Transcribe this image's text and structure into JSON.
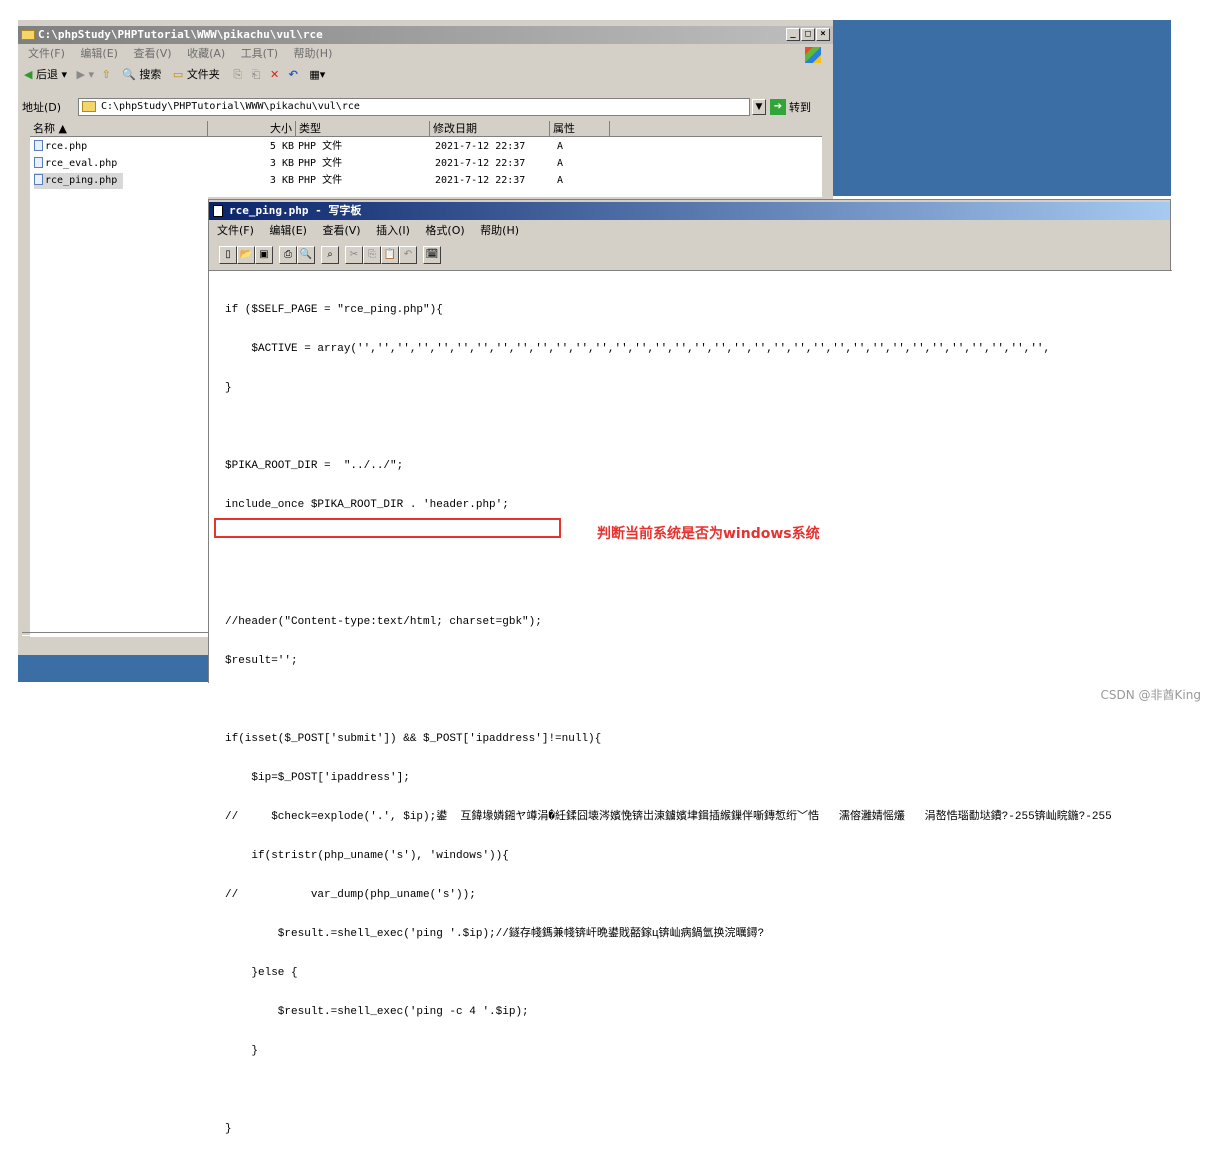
{
  "explorer": {
    "title": "C:\\phpStudy\\PHPTutorial\\WWW\\pikachu\\vul\\rce",
    "menu": [
      "文件(F)",
      "编辑(E)",
      "查看(V)",
      "收藏(A)",
      "工具(T)",
      "帮助(H)"
    ],
    "toolbar": {
      "back": "后退",
      "search": "搜索",
      "folders": "文件夹"
    },
    "address_label": "地址(D)",
    "address_value": "C:\\phpStudy\\PHPTutorial\\WWW\\pikachu\\vul\\rce",
    "go_label": "转到",
    "columns": {
      "name": "名称 ▲",
      "size": "大小",
      "type": "类型",
      "modified": "修改日期",
      "attr": "属性"
    },
    "files": [
      {
        "name": "rce.php",
        "size": "5 KB",
        "type": "PHP 文件",
        "modified": "2021-7-12 22:37",
        "attr": "A"
      },
      {
        "name": "rce_eval.php",
        "size": "3 KB",
        "type": "PHP 文件",
        "modified": "2021-7-12 22:37",
        "attr": "A"
      },
      {
        "name": "rce_ping.php",
        "size": "3 KB",
        "type": "PHP 文件",
        "modified": "2021-7-12 22:37",
        "attr": "A"
      }
    ]
  },
  "wordpad": {
    "title": "rce_ping.php - 写字板",
    "menu": [
      "文件(F)",
      "编辑(E)",
      "查看(V)",
      "插入(I)",
      "格式(O)",
      "帮助(H)"
    ],
    "code_lines": [
      "if ($SELF_PAGE = \"rce_ping.php\"){",
      "    $ACTIVE = array('','','','','','','','','','','','','','','','','','','','','','','','','','','','','','','','','','','',",
      "}",
      "",
      "$PIKA_ROOT_DIR =  \"../../\";",
      "include_once $PIKA_ROOT_DIR . 'header.php';",
      "",
      "",
      "//header(\"Content-type:text/html; charset=gbk\");",
      "$result='';",
      "",
      "if(isset($_POST['submit']) && $_POST['ipaddress']!=null){",
      "    $ip=$_POST['ipaddress'];",
      "//     $check=explode('.', $ip);鍙  互鍏堟嫾鎺ヤ竴涓�紝鍒囧壊涔嬪悗锛岀湅鐪嬪垏鍓插緱鏁伴噺鏄惁绗﹀悎   濡傛灉婧愮爜   涓嶅悎瑙勫垯鐨?-255锛屾睆鍦?-255",
      "    if(stristr(php_uname('s'), 'windows')){",
      "//           var_dump(php_uname('s'));",
      "        $result.=shell_exec('ping '.$ip);//鐩存帴鎷兼帴锛屽晩鍙戝嚭鎵ц锛屾病鍋氫换浣曞鐞?",
      "    }else {",
      "        $result.=shell_exec('ping -c 4 '.$ip);",
      "    }",
      "",
      "}"
    ]
  },
  "annotation": "判断当前系统是否为windows系统",
  "watermark": "CSDN @非酋King"
}
